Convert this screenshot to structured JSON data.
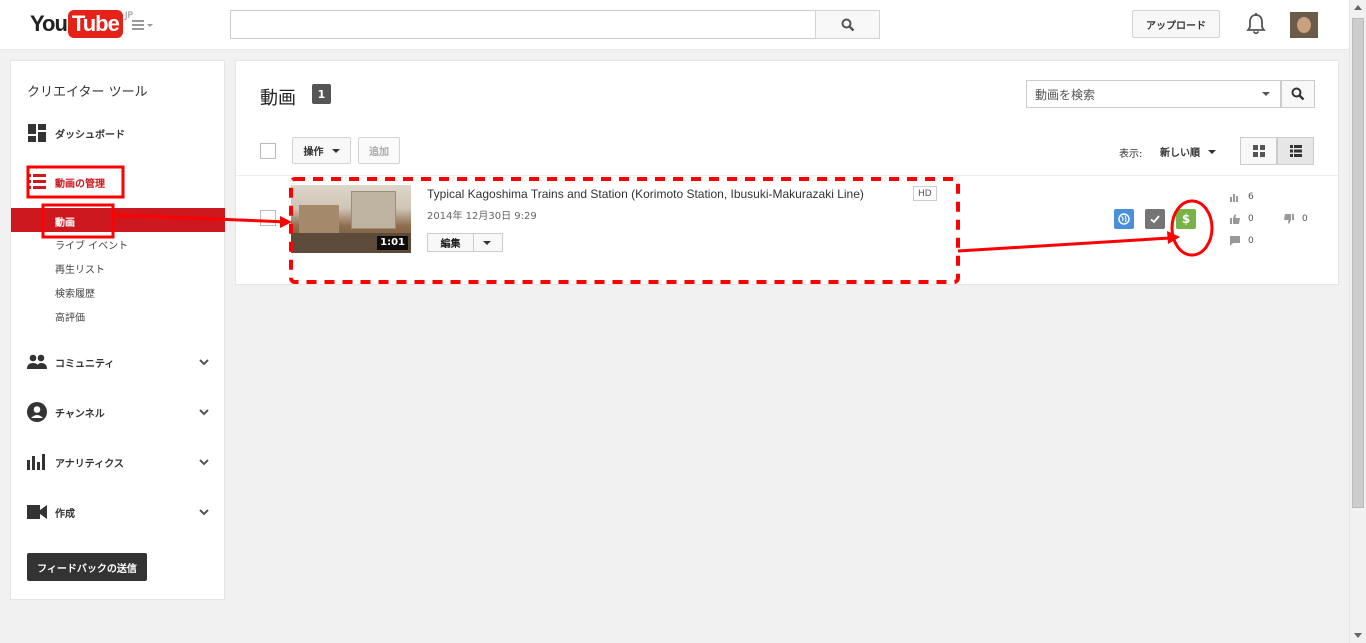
{
  "header": {
    "logo_you": "You",
    "logo_tube": "Tube",
    "logo_region": "JP",
    "upload_label": "アップロード",
    "search_value": ""
  },
  "sidebar": {
    "title": "クリエイター ツール",
    "dashboard": "ダッシュボード",
    "video_manager": "動画の管理",
    "sub_items": [
      "動画",
      "ライブ イベント",
      "再生リスト",
      "検索履歴",
      "高評価"
    ],
    "community": "コミュニティ",
    "channel": "チャンネル",
    "analytics": "アナリティクス",
    "create": "作成",
    "feedback": "フィードバックの送信"
  },
  "main": {
    "title": "動画",
    "count": "1",
    "search_placeholder": "動画を検索",
    "actions_label": "操作",
    "add_label": "追加",
    "sort_label": "表示:",
    "sort_value": "新しい順"
  },
  "video": {
    "title": "Typical Kagoshima Trains and Station (Korimoto Station, Ibusuki-Makurazaki Line)",
    "quality": "HD",
    "date": "2014年 12月30日  9:29",
    "duration": "1:01",
    "edit_label": "編集",
    "views": "6",
    "likes": "0",
    "dislikes": "0",
    "comments": "0",
    "monetization_symbol": "$"
  },
  "colors": {
    "brand_red": "#e62117",
    "active_red": "#cc181e",
    "public_blue": "#4a90d9",
    "monetize_green": "#77b347",
    "annotation_red": "#ff0000"
  },
  "icons": [
    "search-icon",
    "guide-menu-icon",
    "bell-icon",
    "dashboard-icon",
    "video-manager-icon",
    "community-icon",
    "channel-icon",
    "analytics-icon",
    "create-icon",
    "chevron-down-icon",
    "grid-view-icon",
    "list-view-icon",
    "globe-icon",
    "check-icon",
    "dollar-icon",
    "views-icon",
    "thumbs-up-icon",
    "thumbs-down-icon",
    "comment-icon"
  ]
}
